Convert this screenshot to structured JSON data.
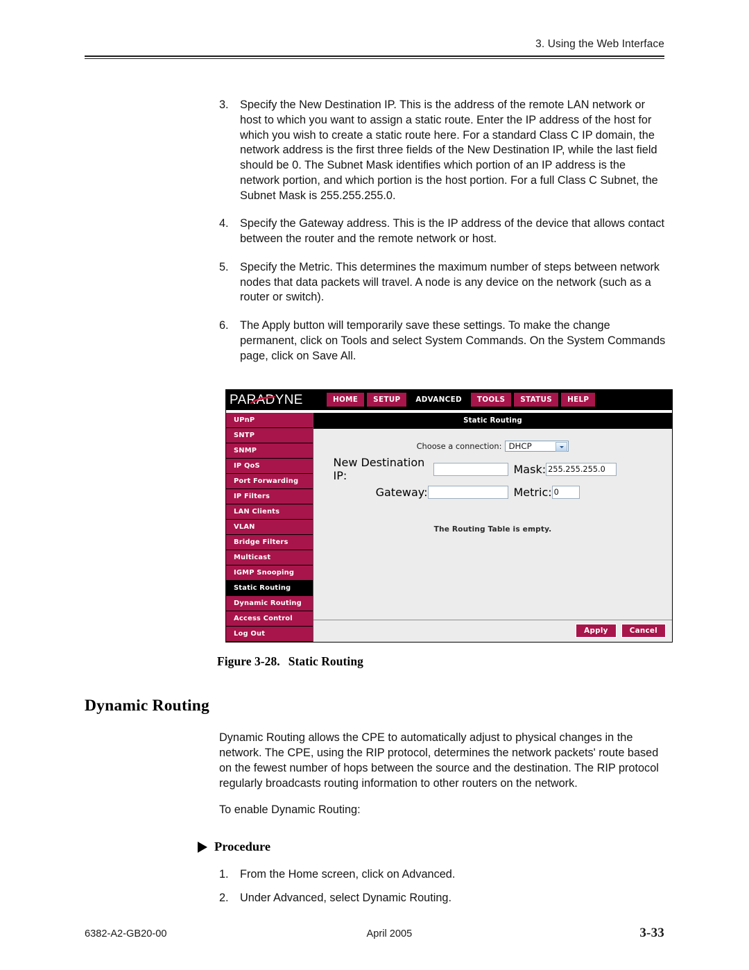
{
  "header": {
    "running_head": "3. Using the Web Interface"
  },
  "steps": [
    {
      "num": "3.",
      "text": "Specify the New Destination IP. This is the address of the remote LAN network or host to which you want to assign a static route. Enter the IP address of the host for which you wish to create a static route here. For a standard Class C IP domain, the network address is the first three fields of the New Destination IP, while the last field should be 0. The Subnet Mask identifies which portion of an IP address is the network portion, and which portion is the host portion. For a full Class C Subnet, the Subnet Mask is 255.255.255.0."
    },
    {
      "num": "4.",
      "text": "Specify the Gateway address. This is the IP address of the device that allows contact between the router and the remote network or host."
    },
    {
      "num": "5.",
      "text": "Specify the Metric. This determines the maximum number of steps between network nodes that data packets will travel. A node is any device on the network (such as a router or switch)."
    },
    {
      "num": "6.",
      "text": "The Apply button will temporarily save these settings. To make the change permanent, click on Tools and select System Commands. On the System Commands page, click on Save All."
    }
  ],
  "router_ui": {
    "logo": "PARADYNE",
    "nav": [
      {
        "label": "HOME",
        "active": false
      },
      {
        "label": "SETUP",
        "active": false
      },
      {
        "label": "ADVANCED",
        "active": true
      },
      {
        "label": "TOOLS",
        "active": false
      },
      {
        "label": "STATUS",
        "active": false
      },
      {
        "label": "HELP",
        "active": false
      }
    ],
    "sidebar": [
      {
        "label": "UPnP",
        "active": false
      },
      {
        "label": "SNTP",
        "active": false
      },
      {
        "label": "SNMP",
        "active": false
      },
      {
        "label": "IP QoS",
        "active": false
      },
      {
        "label": "Port Forwarding",
        "active": false
      },
      {
        "label": "IP Filters",
        "active": false
      },
      {
        "label": "LAN Clients",
        "active": false
      },
      {
        "label": "VLAN",
        "active": false
      },
      {
        "label": "Bridge Filters",
        "active": false
      },
      {
        "label": "Multicast",
        "active": false
      },
      {
        "label": "IGMP Snooping",
        "active": false
      },
      {
        "label": "Static Routing",
        "active": true
      },
      {
        "label": "Dynamic Routing",
        "active": false
      },
      {
        "label": "Access Control",
        "active": false
      },
      {
        "label": "Log Out",
        "active": false
      }
    ],
    "panel_title": "Static Routing",
    "form": {
      "connection_label": "Choose a connection:",
      "connection_value": "DHCP",
      "destination_label": "New Destination IP:",
      "destination_value": "",
      "mask_label": "Mask:",
      "mask_value": "255.255.255.0",
      "gateway_label": "Gateway:",
      "gateway_value": "",
      "metric_label": "Metric:",
      "metric_value": "0"
    },
    "empty_message": "The Routing Table is empty.",
    "buttons": {
      "apply": "Apply",
      "cancel": "Cancel"
    },
    "colors": {
      "crimson": "#a8154a",
      "panel_bg": "#ececec",
      "title_bar": "#000000"
    }
  },
  "figure": {
    "number": "Figure 3-28.",
    "title": "Static Routing"
  },
  "section": {
    "heading": "Dynamic Routing",
    "paragraph": "Dynamic Routing allows the CPE to automatically adjust to physical changes in the network. The CPE, using the RIP protocol, determines the network packets' route based on the fewest number of hops between the source and the destination. The RIP protocol regularly broadcasts routing information to other routers on the network.",
    "lead_in": "To enable Dynamic Routing:",
    "procedure_heading": "Procedure",
    "procedure_steps": [
      {
        "num": "1.",
        "text": "From the Home screen, click on Advanced."
      },
      {
        "num": "2.",
        "text": "Under Advanced, select Dynamic Routing."
      }
    ]
  },
  "footer": {
    "doc_number": "6382-A2-GB20-00",
    "date": "April 2005",
    "page_number": "3-33"
  }
}
